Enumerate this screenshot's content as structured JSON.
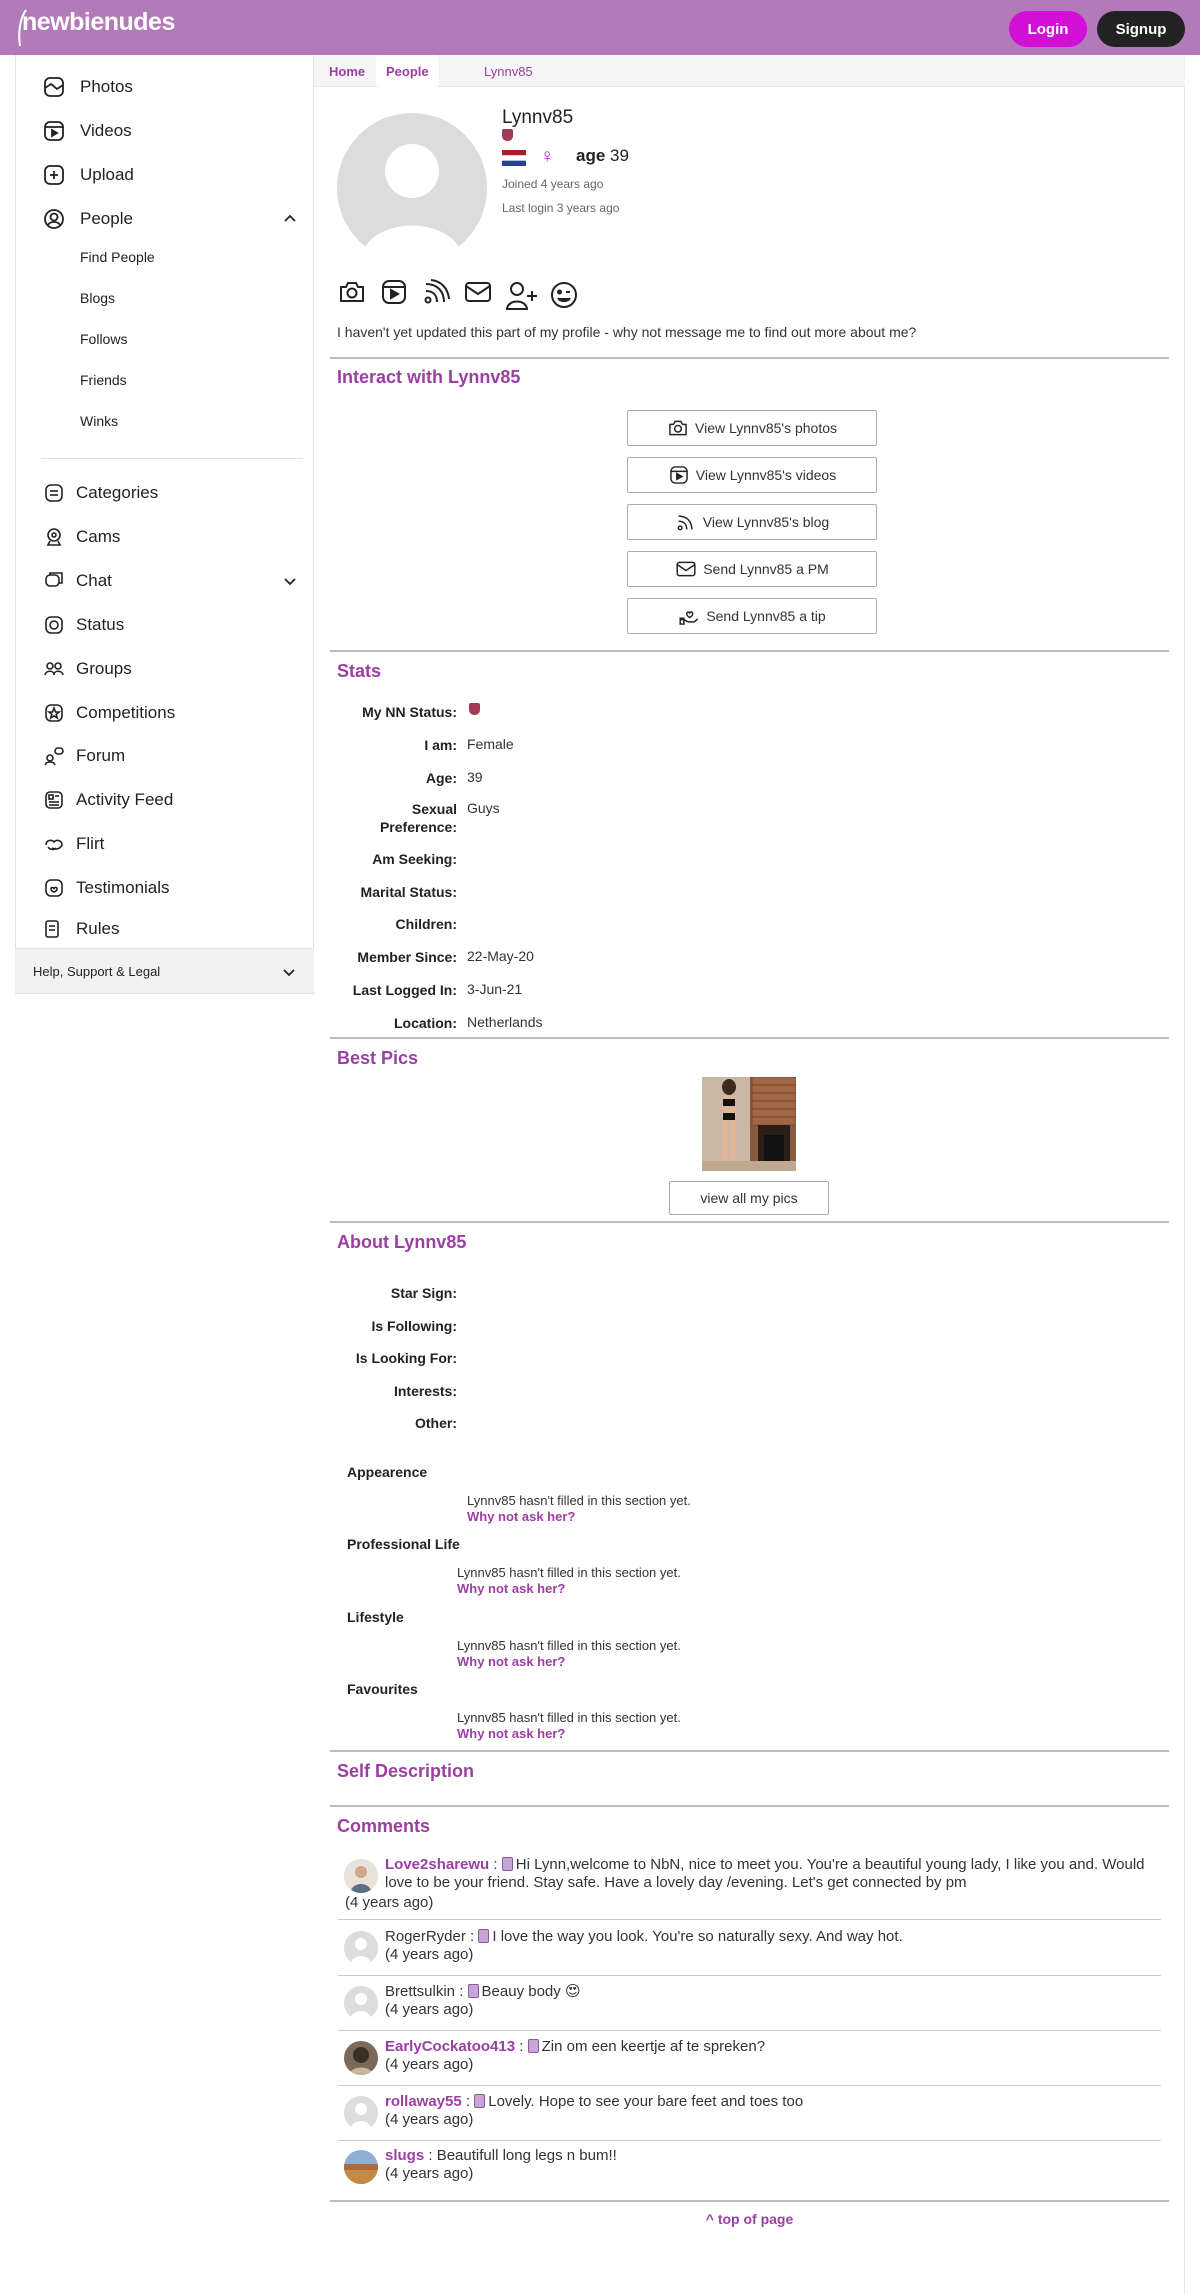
{
  "header": {
    "logo_text": "newbienudes",
    "login_label": "Login",
    "signup_label": "Signup"
  },
  "sidebar": {
    "items": [
      {
        "label": "Photos",
        "icon": "photos-icon"
      },
      {
        "label": "Videos",
        "icon": "videos-icon"
      },
      {
        "label": "Upload",
        "icon": "upload-icon"
      },
      {
        "label": "People",
        "icon": "people-icon"
      }
    ],
    "people_sub": [
      "Find People",
      "Blogs",
      "Follows",
      "Friends",
      "Winks"
    ],
    "items2": [
      {
        "label": "Categories",
        "icon": "categories-icon"
      },
      {
        "label": "Cams",
        "icon": "cams-icon"
      },
      {
        "label": "Chat",
        "icon": "chat-icon"
      },
      {
        "label": "Status",
        "icon": "status-icon"
      },
      {
        "label": "Groups",
        "icon": "groups-icon"
      },
      {
        "label": "Competitions",
        "icon": "competitions-icon"
      },
      {
        "label": "Forum",
        "icon": "forum-icon"
      },
      {
        "label": "Activity Feed",
        "icon": "activity-feed-icon"
      },
      {
        "label": "Flirt",
        "icon": "flirt-icon"
      },
      {
        "label": "Testimonials",
        "icon": "testimonials-icon"
      },
      {
        "label": "Rules",
        "icon": "rules-icon"
      }
    ],
    "help_label": "Help, Support & Legal"
  },
  "breadcrumb": {
    "home": "Home",
    "people": "People",
    "current": "Lynnv85"
  },
  "profile": {
    "username": "Lynnv85",
    "gender_symbol": "♀",
    "age_label": "age",
    "age": "39",
    "joined": "Joined 4 years ago",
    "last_login": "Last login 3 years ago",
    "about": "I haven't yet updated this part of my profile - why not message me to find out more about me?",
    "flag_colors": [
      "#ae1c28",
      "#ffffff",
      "#21468b"
    ]
  },
  "interact": {
    "title": "Interact with Lynnv85",
    "buttons": [
      "View Lynnv85's photos",
      "View Lynnv85's videos",
      "View Lynnv85's blog",
      "Send Lynnv85 a PM",
      "Send Lynnv85 a tip"
    ]
  },
  "stats": {
    "title": "Stats",
    "rows": [
      {
        "k": "My NN Status:",
        "v": ""
      },
      {
        "k": "I am:",
        "v": "Female"
      },
      {
        "k": "Age:",
        "v": "39"
      },
      {
        "k": "Sexual Preference:",
        "v": "Guys"
      },
      {
        "k": "Am Seeking:",
        "v": ""
      },
      {
        "k": "Marital Status:",
        "v": ""
      },
      {
        "k": "Children:",
        "v": ""
      },
      {
        "k": "Member Since:",
        "v": "22-May-20"
      },
      {
        "k": "Last Logged In:",
        "v": "3-Jun-21"
      },
      {
        "k": "Location:",
        "v": "Netherlands"
      }
    ]
  },
  "best_pics": {
    "title": "Best Pics",
    "view_all": "view all my pics"
  },
  "about": {
    "title": "About Lynnv85",
    "rows": [
      "Star Sign:",
      "Is Following:",
      "Is Looking For:",
      "Interests:",
      "Other:"
    ],
    "sections": [
      {
        "head": "Appearence",
        "text": "Lynnv85 hasn't filled in this section yet.",
        "ask": "Why not ask her?"
      },
      {
        "head": "Professional Life",
        "text": "Lynnv85 hasn't filled in this section yet.",
        "ask": "Why not ask her?"
      },
      {
        "head": "Lifestyle",
        "text": "Lynnv85 hasn't filled in this section yet.",
        "ask": "Why not ask her?"
      },
      {
        "head": "Favourites",
        "text": "Lynnv85 hasn't filled in this section yet.",
        "ask": "Why not ask her?"
      }
    ]
  },
  "self_description": {
    "title": "Self Description"
  },
  "comments": {
    "title": "Comments",
    "items": [
      {
        "name": "Love2sharewu",
        "text": "Hi Lynn,welcome to NbN, nice to meet you. You're a beautiful young lady, I like you and. Would love to be your friend. Stay safe. Have a lovely day /evening. Let's get connected by pm",
        "time": "(4 years ago)"
      },
      {
        "name": "RogerRyder",
        "text": "I love the way you look. You're so naturally sexy. And way hot.",
        "time": "(4 years ago)"
      },
      {
        "name": "Brettsulkin",
        "text": "Beauy body 😍",
        "time": "(4 years ago)"
      },
      {
        "name": "EarlyCockatoo413",
        "text": "Zin om een keertje af te spreken?",
        "time": "(4 years ago)"
      },
      {
        "name": "rollaway55",
        "text": "Lovely. Hope to see your bare feet and toes too",
        "time": "(4 years ago)"
      },
      {
        "name": "slugs",
        "text": "Beautifull long legs n bum!!",
        "time": "(4 years ago)"
      }
    ],
    "separator": " : "
  },
  "footer": {
    "top_link": "^ top of page"
  }
}
